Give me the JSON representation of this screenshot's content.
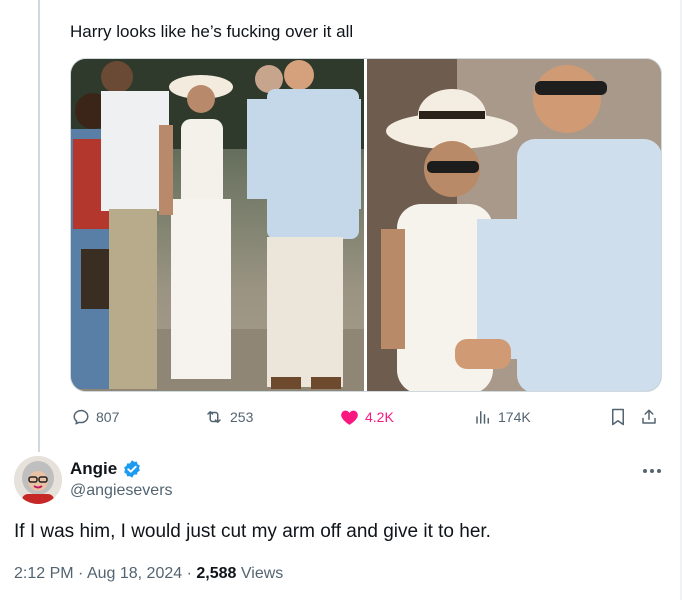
{
  "quoted_tweet": {
    "text": "Harry looks like he’s fucking over it all",
    "stats": {
      "replies": "807",
      "retweets": "253",
      "likes": "4.2K",
      "views": "174K"
    }
  },
  "tweet": {
    "author_name": "Angie",
    "author_handle": "@angiesevers",
    "text": "If I was him, I would just cut my arm off and give it to her.",
    "time": "2:12 PM",
    "date": "Aug 18, 2024",
    "views_count": "2,588",
    "views_label": "Views",
    "separator": "·"
  },
  "icons": {
    "reply": "reply-icon",
    "retweet": "retweet-icon",
    "like": "heart-icon",
    "views": "views-chart-icon",
    "bookmark": "bookmark-icon",
    "share": "share-icon",
    "verified": "verified-badge-icon",
    "more": "more-options-icon"
  },
  "colors": {
    "like_active": "#f91880",
    "verified": "#1d9bf0",
    "secondary_text": "#536471"
  }
}
